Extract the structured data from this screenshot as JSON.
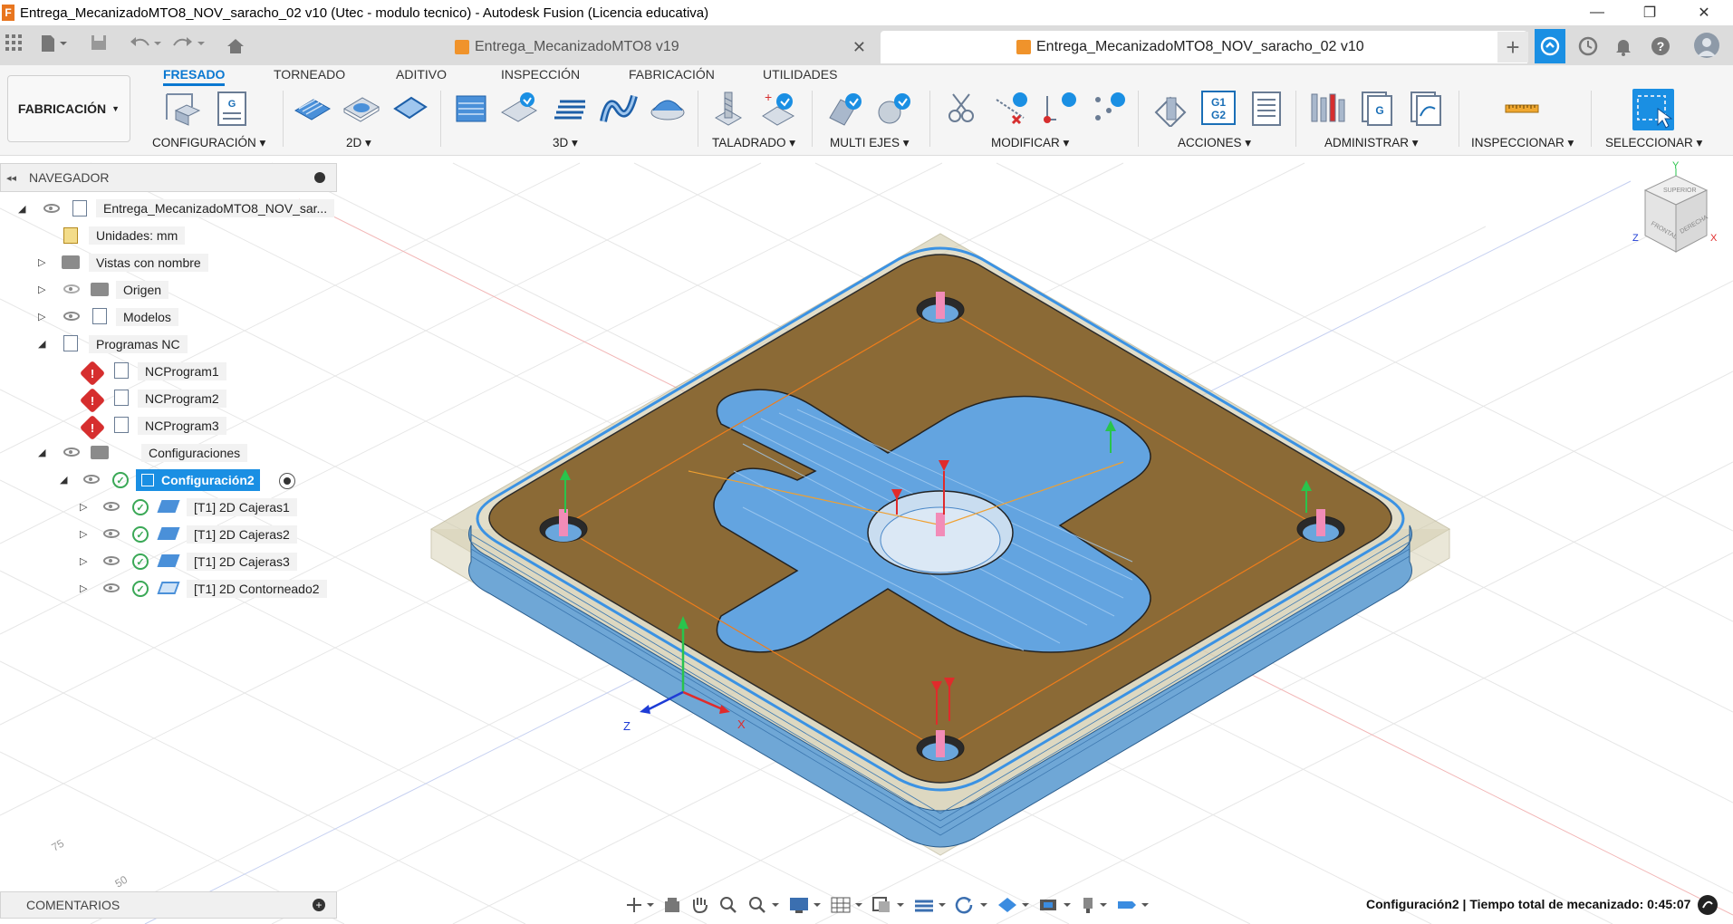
{
  "window": {
    "title": "Entrega_MecanizadoMTO8_NOV_saracho_02 v10 (Utec - modulo tecnico) - Autodesk Fusion (Licencia educativa)",
    "app_icon_letter": "F",
    "minimize": "—",
    "maximize": "❐",
    "close": "✕"
  },
  "tabs": [
    {
      "label": "Entrega_MecanizadoMTO8 v19",
      "active": false
    },
    {
      "label": "Entrega_MecanizadoMTO8_NOV_saracho_02 v10",
      "active": true
    }
  ],
  "toolbar": {
    "workspace": "FABRICACIÓN",
    "ribbon_tabs": [
      "FRESADO",
      "TORNEADO",
      "ADITIVO",
      "INSPECCIÓN",
      "FABRICACIÓN",
      "UTILIDADES"
    ],
    "groups": {
      "configuracion": "CONFIGURACIÓN",
      "g2d": "2D",
      "g3d": "3D",
      "taladrado": "TALADRADO",
      "multiejes": "MULTI EJES",
      "modificar": "MODIFICAR",
      "acciones": "ACCIONES",
      "administrar": "ADMINISTRAR",
      "inspeccionar": "INSPECCIONAR",
      "seleccionar": "SELECCIONAR"
    },
    "g1g2": "G1\nG2"
  },
  "browser": {
    "header": "NAVEGADOR",
    "root": "Entrega_MecanizadoMTO8_NOV_sar...",
    "units": "Unidades: mm",
    "named_views": "Vistas con nombre",
    "origin": "Origen",
    "models": "Modelos",
    "nc_programs": "Programas NC",
    "programs": [
      "NCProgram1",
      "NCProgram2",
      "NCProgram3"
    ],
    "setups": "Configuraciones",
    "setup": "Configuración2",
    "operations": [
      "[T1] 2D Cajeras1",
      "[T1] 2D Cajeras2",
      "[T1] 2D Cajeras3",
      "[T1] 2D Contorneado2"
    ]
  },
  "viewcube": {
    "top": "SUPERIOR",
    "front": "FRONTAL",
    "right": "DERECHA",
    "z": "Z",
    "x": "X",
    "y": "Y"
  },
  "triad": {
    "z": "Z",
    "x": "X"
  },
  "grid_labels": [
    "75",
    "50"
  ],
  "comments": "COMENTARIOS",
  "status": "Configuración2 | Tiempo total de mecanizado: 0:45:07",
  "colors": {
    "accent": "#0a78d1",
    "stock": "#8b6a36",
    "toolpath": "#3b92e3",
    "warning": "#d62e2e",
    "check": "#3aa856"
  }
}
